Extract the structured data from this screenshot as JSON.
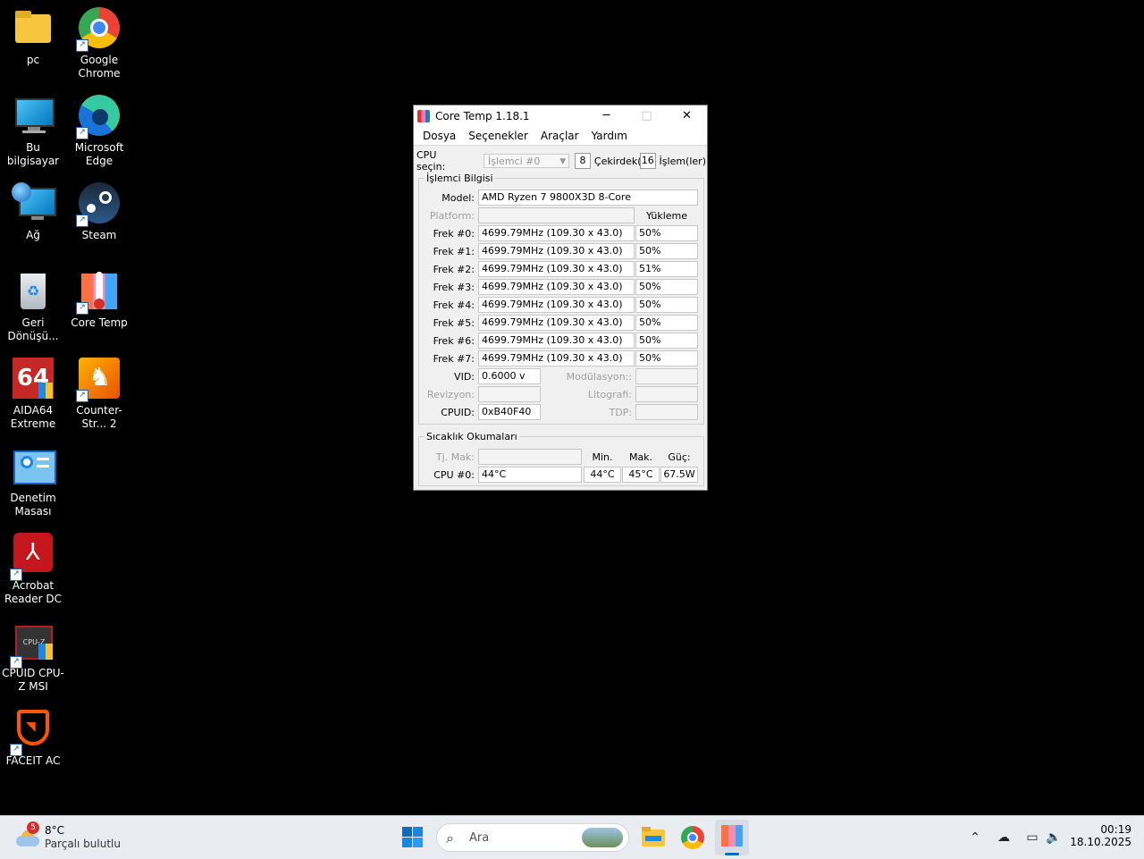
{
  "desktop": {
    "icons": [
      {
        "label": "pc"
      },
      {
        "label": "Google Chrome"
      },
      {
        "label": "Bu bilgisayar"
      },
      {
        "label": "Microsoft Edge"
      },
      {
        "label": "Ağ"
      },
      {
        "label": "Steam"
      },
      {
        "label": "Geri Dönüşü..."
      },
      {
        "label": "Core Temp"
      },
      {
        "label": "AIDA64 Extreme"
      },
      {
        "label": "Counter-Str... 2"
      },
      {
        "label": "Denetim Masası"
      },
      {
        "label": "Acrobat Reader DC"
      },
      {
        "label": "CPUID CPU-Z MSI"
      },
      {
        "label": "FACEIT AC"
      }
    ]
  },
  "window": {
    "title": "Core Temp 1.18.1",
    "controls": {
      "minimize": "─",
      "maximize": "□",
      "close": "✕"
    },
    "menu": [
      "Dosya",
      "Seçenekler",
      "Araçlar",
      "Yardım"
    ],
    "cpu_select": {
      "label": "CPU seçin:",
      "selected": "İşlemci #0",
      "cores": "8",
      "cores_label": "Çekirdek(le",
      "threads": "16",
      "threads_label": "İşlem(ler)"
    },
    "info": {
      "group_title": "İşlemci Bilgisi",
      "model_label": "Model:",
      "model": "AMD Ryzen 7 9800X3D 8-Core",
      "platform_label": "Platform:",
      "load_header": "Yükleme",
      "freqs": [
        {
          "label": "Frek #0:",
          "value": "4699.79MHz (109.30 x 43.0)",
          "load": "50%"
        },
        {
          "label": "Frek #1:",
          "value": "4699.79MHz (109.30 x 43.0)",
          "load": "50%"
        },
        {
          "label": "Frek #2:",
          "value": "4699.79MHz (109.30 x 43.0)",
          "load": "51%"
        },
        {
          "label": "Frek #3:",
          "value": "4699.79MHz (109.30 x 43.0)",
          "load": "50%"
        },
        {
          "label": "Frek #4:",
          "value": "4699.79MHz (109.30 x 43.0)",
          "load": "50%"
        },
        {
          "label": "Frek #5:",
          "value": "4699.79MHz (109.30 x 43.0)",
          "load": "50%"
        },
        {
          "label": "Frek #6:",
          "value": "4699.79MHz (109.30 x 43.0)",
          "load": "50%"
        },
        {
          "label": "Frek #7:",
          "value": "4699.79MHz (109.30 x 43.0)",
          "load": "50%"
        }
      ],
      "vid_label": "VID:",
      "vid": "0.6000 v",
      "modulation_label": "Modülasyon::",
      "revision_label": "Revizyon:",
      "lithography_label": "Litografi:",
      "cpuid_label": "CPUID:",
      "cpuid": "0xB40F40",
      "tdp_label": "TDP:"
    },
    "temps": {
      "group_title": "Sıcaklık Okumaları",
      "tjmax_label": "Tj. Mak:",
      "min_header": "Min.",
      "max_header": "Mak.",
      "power_header": "Güç:",
      "cpu_label": "CPU #0:",
      "cpu_temp": "44°C",
      "cpu_min": "44°C",
      "cpu_max": "45°C",
      "power": "67.5W"
    }
  },
  "taskbar": {
    "weather_badge": "5",
    "weather_temp": "8°C",
    "weather_desc": "Parçalı bulutlu",
    "search_placeholder": "Ara",
    "time": "00:19",
    "date": "18.10.2025",
    "icons": [
      "start-icon",
      "search-icon",
      "file-explorer-icon",
      "chrome-icon",
      "core-temp-icon",
      "chevron-up-icon",
      "network-off-icon",
      "display-icon",
      "volume-icon"
    ]
  }
}
